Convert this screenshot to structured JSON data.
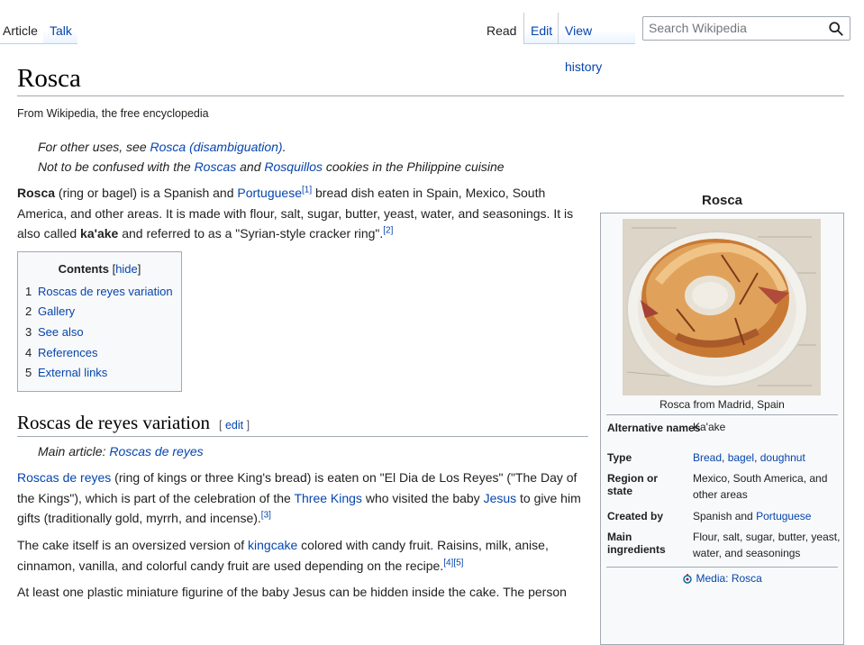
{
  "tabs": {
    "article": "Article",
    "talk": "Talk",
    "read": "Read",
    "edit": "Edit",
    "history": "View history"
  },
  "search": {
    "placeholder": "Search Wikipedia"
  },
  "page": {
    "title": "Rosca",
    "tagline": "From Wikipedia, the free encyclopedia"
  },
  "hatnote1": {
    "pre": "For other uses, see ",
    "link": "Rosca (disambiguation)",
    "post": "."
  },
  "hatnote2": {
    "pre": "Not to be confused with the ",
    "link1": "Roscas",
    "mid": " and ",
    "link2": "Rosquillos",
    "post": " cookies in the Philippine cuisine"
  },
  "intro": {
    "bold1": "Rosca",
    "t1": " (ring or bagel) is a Spanish and ",
    "link1": "Portuguese",
    "ref1": "[1]",
    "t2": " bread dish eaten in Spain, Mexico, South America, and other areas. It is made with flour, salt, sugar, butter, yeast, water, and seasonings. It is also called ",
    "bold2": "ka'ake",
    "t3": " and referred to as a \"Syrian-style cracker ring\".",
    "ref2": "[2]"
  },
  "toc": {
    "title": "Contents",
    "hide": "hide",
    "items": [
      {
        "num": "1",
        "label": "Roscas de reyes variation"
      },
      {
        "num": "2",
        "label": "Gallery"
      },
      {
        "num": "3",
        "label": "See also"
      },
      {
        "num": "4",
        "label": "References"
      },
      {
        "num": "5",
        "label": "External links"
      }
    ]
  },
  "section1": {
    "heading": "Roscas de reyes variation",
    "edit": "edit",
    "main_pre": "Main article: ",
    "main_link": "Roscas de reyes",
    "p1": {
      "link1": "Roscas de reyes",
      "t1": " (ring of kings or three King's bread) is eaten on \"El Dia de Los Reyes\" (\"The Day of the Kings\"), which is part of the celebration of the ",
      "link2": "Three Kings",
      "t2": " who visited the baby ",
      "link3": "Jesus",
      "t3": " to give him gifts (traditionally gold, myrrh, and incense).",
      "ref": "[3]"
    },
    "p2": {
      "t1": "The cake itself is an oversized version of ",
      "link1": "kingcake",
      "t2": " colored with candy fruit. Raisins, milk, anise, cinnamon, vanilla, and colorful candy fruit are used depending on the recipe.",
      "ref1": "[4]",
      "ref2": "[5]"
    },
    "p3": "At least one plastic miniature figurine of the baby Jesus can be hidden inside the cake. The person"
  },
  "infobox": {
    "title": "Rosca",
    "caption": "Rosca from Madrid, Spain",
    "rows": {
      "alt_label": "Alternative names",
      "alt_value": "Ka'ake",
      "type_label": "Type",
      "type_links": [
        "Bread",
        "bagel",
        "doughnut"
      ],
      "region_label": "Region or state",
      "region_value": "Mexico, South America, and other areas",
      "created_label": "Created by",
      "created_pre": "Spanish and ",
      "created_link": "Portuguese",
      "ingr_label": "Main ingredients",
      "ingr_value": "Flour, salt, sugar, butter, yeast, water, and seasonings"
    },
    "media": "Media: Rosca"
  }
}
